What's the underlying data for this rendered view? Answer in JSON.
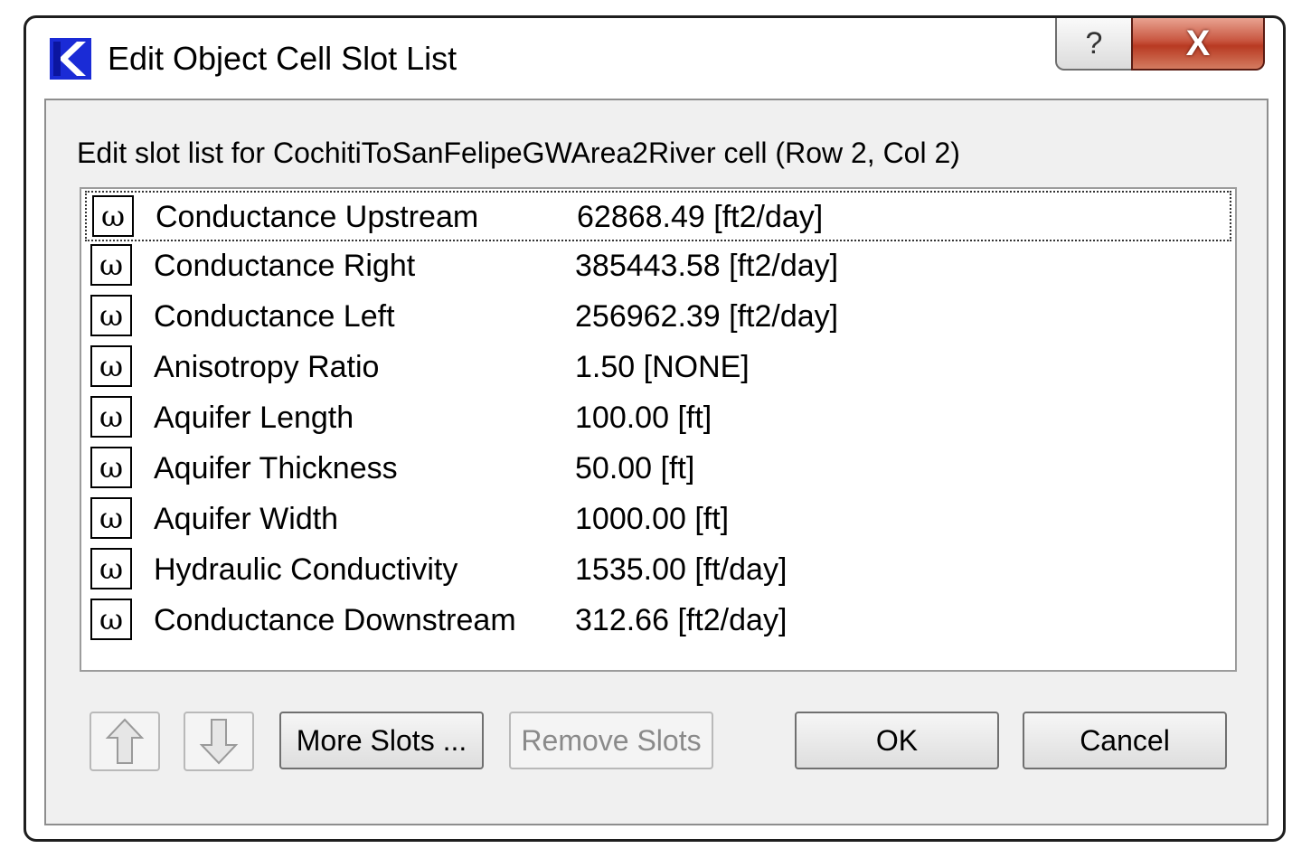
{
  "window": {
    "title": "Edit Object Cell Slot List",
    "help_glyph": "?",
    "close_glyph": "X",
    "app_icon": "riverware-r-icon"
  },
  "dialog": {
    "prompt": "Edit slot list for CochitiToSanFelipeGWArea2River cell (Row 2, Col 2)",
    "slot_icon_glyph": "ω",
    "slots": [
      {
        "name": "Conductance Upstream",
        "value": "62868.49 [ft2/day]"
      },
      {
        "name": "Conductance Right",
        "value": "385443.58 [ft2/day]"
      },
      {
        "name": "Conductance Left",
        "value": "256962.39 [ft2/day]"
      },
      {
        "name": "Anisotropy Ratio",
        "value": "1.50 [NONE]"
      },
      {
        "name": "Aquifer Length",
        "value": "100.00 [ft]"
      },
      {
        "name": "Aquifer Thickness",
        "value": "50.00 [ft]"
      },
      {
        "name": "Aquifer Width",
        "value": "1000.00 [ft]"
      },
      {
        "name": "Hydraulic Conductivity",
        "value": "1535.00 [ft/day]"
      },
      {
        "name": "Conductance Downstream",
        "value": "312.66 [ft2/day]"
      }
    ],
    "buttons": {
      "move_up": "arrow-up-icon",
      "move_down": "arrow-down-icon",
      "more_slots": "More Slots ...",
      "remove_slots": "Remove Slots",
      "ok": "OK",
      "cancel": "Cancel"
    }
  }
}
